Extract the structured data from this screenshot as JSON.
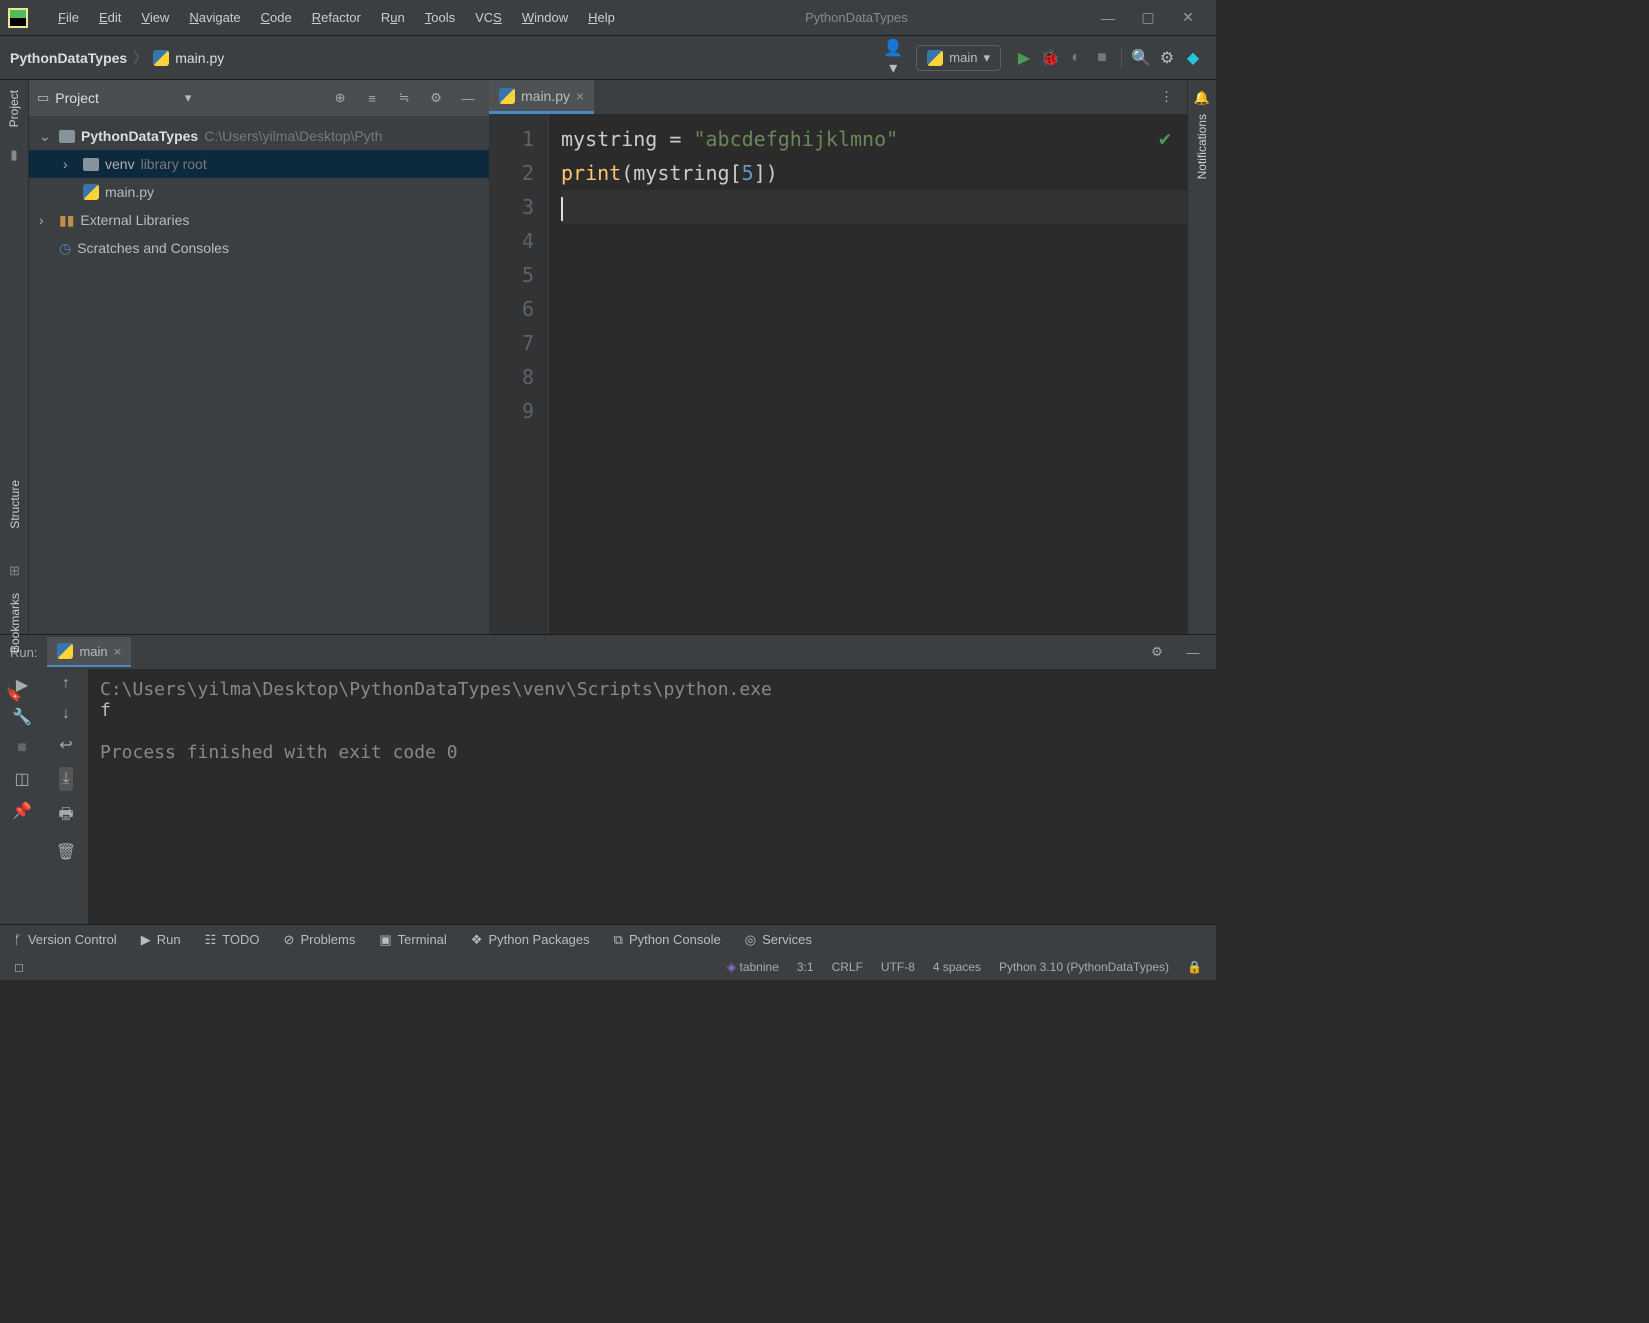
{
  "title": "PythonDataTypes",
  "menu": [
    "File",
    "Edit",
    "View",
    "Navigate",
    "Code",
    "Refactor",
    "Run",
    "Tools",
    "VCS",
    "Window",
    "Help"
  ],
  "breadcrumb": {
    "root": "PythonDataTypes",
    "file": "main.py"
  },
  "runConfig": "main",
  "projectPanel": {
    "title": "Project",
    "tree": {
      "root": "PythonDataTypes",
      "rootPath": "C:\\Users\\yilma\\Desktop\\Pyth",
      "venv": "venv",
      "venvHint": "library root",
      "file": "main.py",
      "ext": "External Libraries",
      "scratch": "Scratches and Consoles"
    }
  },
  "editor": {
    "tab": "main.py",
    "lines": [
      "1",
      "2",
      "3",
      "4",
      "5",
      "6",
      "7",
      "8",
      "9"
    ],
    "code": {
      "l1_var": "mystring",
      "l1_eq": " = ",
      "l1_str": "\"abcdefghijklmno\"",
      "l2_fn": "print",
      "l2_open": "(",
      "l2_var": "mystring",
      "l2_lb": "[",
      "l2_num": "5",
      "l2_rb": "]",
      "l2_close": ")"
    }
  },
  "runPanel": {
    "label": "Run:",
    "tab": "main",
    "output": {
      "cmd": "C:\\Users\\yilma\\Desktop\\PythonDataTypes\\venv\\Scripts\\python.exe ",
      "result": "f",
      "exit": "Process finished with exit code 0"
    }
  },
  "leftRail": {
    "project": "Project",
    "structure": "Structure",
    "bookmarks": "Bookmarks"
  },
  "rightRail": {
    "notifications": "Notifications"
  },
  "bottomBar": {
    "vcs": "Version Control",
    "run": "Run",
    "todo": "TODO",
    "problems": "Problems",
    "terminal": "Terminal",
    "packages": "Python Packages",
    "console": "Python Console",
    "services": "Services"
  },
  "statusBar": {
    "tabnine": "tabnine",
    "pos": "3:1",
    "eol": "CRLF",
    "enc": "UTF-8",
    "indent": "4 spaces",
    "interp": "Python 3.10 (PythonDataTypes)"
  }
}
